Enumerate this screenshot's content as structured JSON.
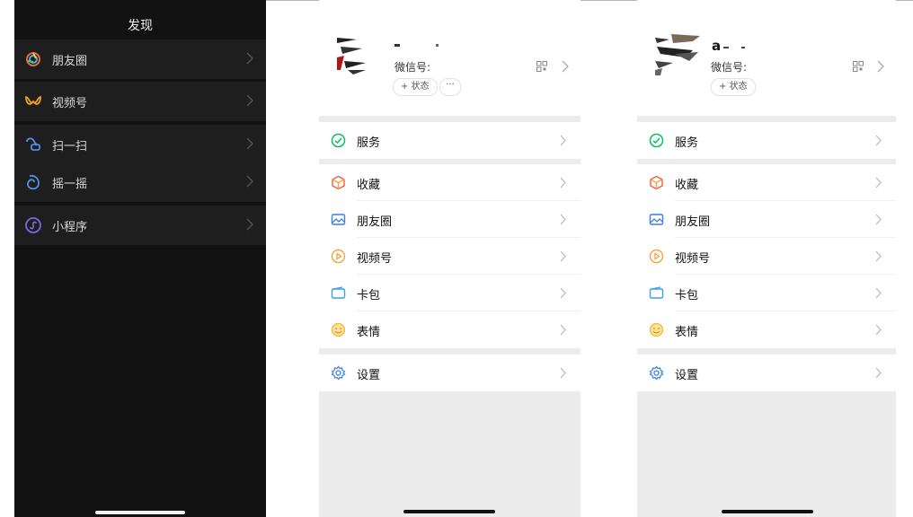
{
  "discover": {
    "title": "发现",
    "items": [
      {
        "label": "朋友圈",
        "icon": "moments-icon"
      },
      {
        "label": "视频号",
        "icon": "channels-icon"
      },
      {
        "label": "扫一扫",
        "icon": "scan-icon"
      },
      {
        "label": "摇一摇",
        "icon": "shake-icon"
      },
      {
        "label": "小程序",
        "icon": "mini-program-icon"
      }
    ]
  },
  "profile_left": {
    "name": "",
    "wechat_id_label": "微信号:",
    "status_button": "+ 状态",
    "more_button": "···"
  },
  "profile_right": {
    "name": "a",
    "wechat_id_label": "微信号:",
    "status_button": "+ 状态"
  },
  "me_menu": {
    "service": "服务",
    "favorites": "收藏",
    "moments": "朋友圈",
    "channels": "视频号",
    "cards": "卡包",
    "stickers": "表情",
    "settings": "设置"
  },
  "colors": {
    "dark_bg": "#121212",
    "dark_row": "#1e1e1e",
    "wechat_green": "#07c160",
    "divider_gray": "#ececec"
  }
}
